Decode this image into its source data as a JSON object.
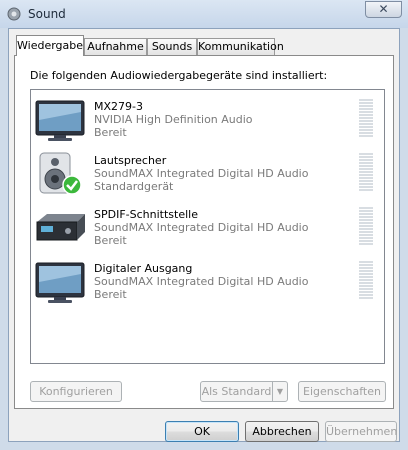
{
  "window": {
    "title": "Sound",
    "close_symbol": "✕"
  },
  "tabs": [
    {
      "label": "Wiedergabe",
      "active": true
    },
    {
      "label": "Aufnahme",
      "active": false
    },
    {
      "label": "Sounds",
      "active": false
    },
    {
      "label": "Kommunikation",
      "active": false
    }
  ],
  "panel": {
    "heading": "Die folgenden Audiowiedergabegeräte sind installiert:",
    "devices": [
      {
        "name": "MX279-3",
        "desc": "NVIDIA High Definition Audio",
        "status": "Bereit",
        "icon": "monitor-icon"
      },
      {
        "name": "Lautsprecher",
        "desc": "SoundMAX Integrated Digital HD Audio",
        "status": "Standardgerät",
        "icon": "speaker-default-icon"
      },
      {
        "name": "SPDIF-Schnittstelle",
        "desc": "SoundMAX Integrated Digital HD Audio",
        "status": "Bereit",
        "icon": "spdif-device-icon"
      },
      {
        "name": "Digitaler Ausgang",
        "desc": "SoundMAX Integrated Digital HD Audio",
        "status": "Bereit",
        "icon": "monitor-icon"
      }
    ],
    "buttons": {
      "configure": "Konfigurieren",
      "set_default": "Als Standard",
      "set_default_arrow": "▼",
      "properties": "Eigenschaften"
    }
  },
  "footer": {
    "ok": "OK",
    "cancel": "Abbrechen",
    "apply": "Übernehmen"
  },
  "colors": {
    "accent_check": "#3cb83c",
    "title_bg": "#c6d6ea",
    "disabled_text": "#a0a0a0"
  }
}
